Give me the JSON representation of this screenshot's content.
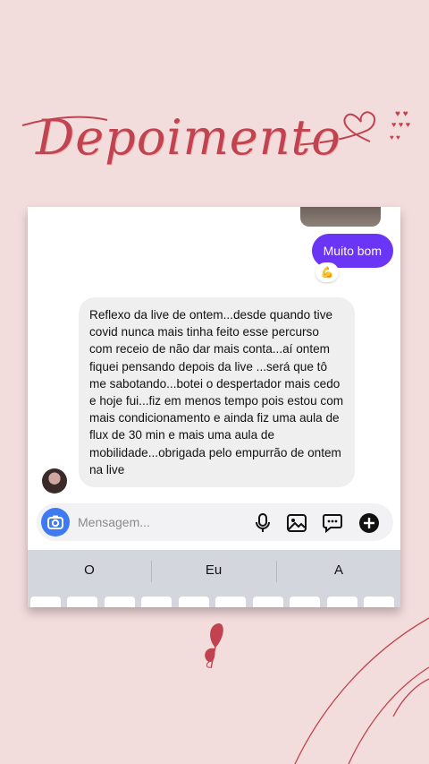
{
  "title": "Depoimento",
  "chat": {
    "sent_message": "Muito bom",
    "reaction_emoji": "💪",
    "received_message": "Reflexo da live de ontem...desde quando tive covid nunca mais tinha feito esse percurso com receio de não dar mais conta...aí ontem fiquei pensando depois da live ...será que tô me sabotando...botei o despertador mais cedo e hoje fui...fiz em menos tempo pois estou com mais condicionamento e ainda fiz uma aula de flux de 30 min e mais uma aula de mobilidade...obrigada pelo empurrão de ontem na live"
  },
  "input_bar": {
    "placeholder": "Mensagem..."
  },
  "keyboard": {
    "suggestions": [
      "O",
      "Eu",
      "A"
    ]
  },
  "colors": {
    "background": "#f3dcdc",
    "accent": "#c0434f",
    "sent_bubble": "#6a35f5",
    "camera_button": "#3e7bf2"
  }
}
